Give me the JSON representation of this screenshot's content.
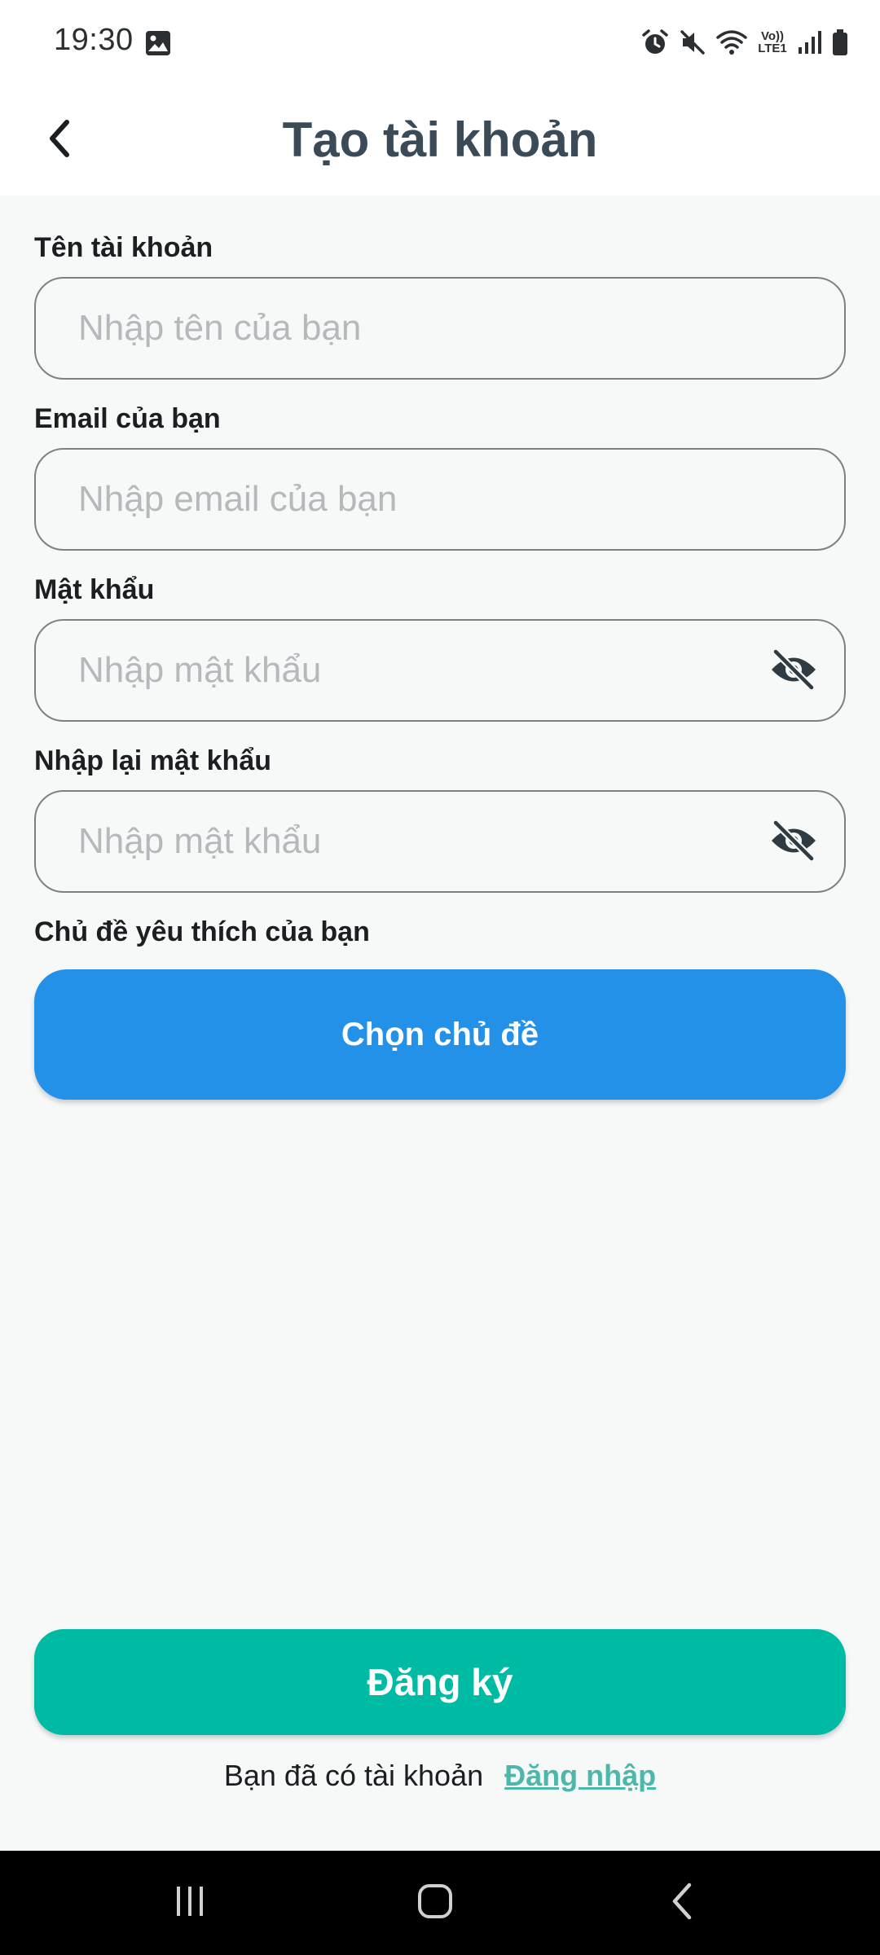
{
  "status_bar": {
    "time": "19:30",
    "network_label_top": "Vo))",
    "network_label_bottom": "LTE1",
    "icons": [
      "gallery-icon",
      "alarm-icon",
      "mute-icon",
      "wifi-icon",
      "signal-icon",
      "battery-icon"
    ]
  },
  "header": {
    "title": "Tạo tài khoản",
    "back_icon": "chevron-left-icon"
  },
  "form": {
    "username": {
      "label": "Tên tài khoản",
      "placeholder": "Nhập tên của bạn",
      "value": ""
    },
    "email": {
      "label": "Email của bạn",
      "placeholder": "Nhập email của bạn",
      "value": ""
    },
    "password": {
      "label": "Mật khẩu",
      "placeholder": "Nhập mật khẩu",
      "value": "",
      "toggle_icon": "eye-off-icon"
    },
    "confirm_password": {
      "label": "Nhập lại mật khẩu",
      "placeholder": "Nhập mật khẩu",
      "value": "",
      "toggle_icon": "eye-off-icon"
    },
    "topics": {
      "label": "Chủ đề yêu thích của bạn",
      "button_label": "Chọn chủ đề"
    }
  },
  "footer": {
    "register_label": "Đăng ký",
    "have_account_text": "Bạn đã có tài khoản",
    "login_link": "Đăng nhập"
  },
  "nav_bar": {
    "buttons": [
      "recent-apps-icon",
      "home-icon",
      "back-icon"
    ]
  },
  "colors": {
    "primary_blue": "#2391e8",
    "primary_teal": "#00bba3",
    "link_teal": "#4db7aa",
    "title": "#3a4a57",
    "background": "#f7f9f9"
  }
}
